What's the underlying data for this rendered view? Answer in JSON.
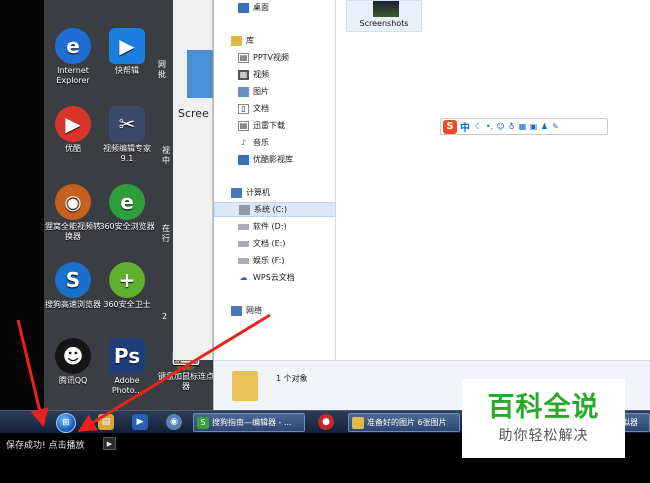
{
  "desktop": {
    "icons": [
      {
        "label": "Internet Explorer",
        "icon": "internet-explorer-icon",
        "color": "#1e6fd1"
      },
      {
        "label": "快帮辑",
        "icon": "video-play-icon",
        "color": "#1a7fe0"
      },
      {
        "label": "优酷",
        "icon": "youku-icon",
        "color": "#d9342b"
      },
      {
        "label": "视频编辑专家 9.1",
        "icon": "video-editor-icon",
        "color": "#3a4a6a"
      },
      {
        "label": "狸窝全能视频转换器",
        "icon": "leawo-converter-icon",
        "color": "#c6601e"
      },
      {
        "label": "360安全浏览器",
        "icon": "360-browser-icon",
        "color": "#2d9e3a"
      },
      {
        "label": "搜狗高速浏览器",
        "icon": "sogou-browser-icon",
        "color": "#1a6fc9"
      },
      {
        "label": "360安全卫士",
        "icon": "360-safe-icon",
        "color": "#5fb02c"
      },
      {
        "label": "腾讯QQ",
        "icon": "qq-icon",
        "color": "#151515"
      },
      {
        "label": "Adobe Photo...",
        "icon": "photoshop-icon",
        "color": "#1c3d7a"
      }
    ],
    "partial_labels": [
      "网",
      "批",
      "视",
      "中",
      "在",
      "行",
      "2"
    ],
    "bottom_partial_label": "键盘加鼠标连点器",
    "back_window_text": "Scree"
  },
  "explorer": {
    "nav": [
      {
        "label": "桌面",
        "icon": "desktop-icon",
        "indent": 1
      },
      {
        "label": "库",
        "icon": "library-icon",
        "indent": 0
      },
      {
        "label": "PPTV视频",
        "icon": "pptv-icon",
        "indent": 1
      },
      {
        "label": "视频",
        "icon": "video-icon",
        "indent": 1
      },
      {
        "label": "图片",
        "icon": "image-icon",
        "indent": 1
      },
      {
        "label": "文档",
        "icon": "document-icon",
        "indent": 1
      },
      {
        "label": "迅雷下载",
        "icon": "thunder-download-icon",
        "indent": 1
      },
      {
        "label": "音乐",
        "icon": "music-icon",
        "indent": 1
      },
      {
        "label": "优酷影视库",
        "icon": "youku-library-icon",
        "indent": 1
      },
      {
        "label": "计算机",
        "icon": "computer-icon",
        "indent": 0
      },
      {
        "label": "系统 (C:)",
        "icon": "drive-c-icon",
        "indent": 1,
        "selected": true
      },
      {
        "label": "软件 (D:)",
        "icon": "drive-icon",
        "indent": 1
      },
      {
        "label": "文档 (E:)",
        "icon": "drive-icon",
        "indent": 1
      },
      {
        "label": "娱乐 (F:)",
        "icon": "drive-icon",
        "indent": 1
      },
      {
        "label": "WPS云文档",
        "icon": "wps-cloud-icon",
        "indent": 1
      },
      {
        "label": "网络",
        "icon": "network-icon",
        "indent": 0
      }
    ],
    "folder_label": "Screenshots",
    "details_count": "1 个对象"
  },
  "ime": {
    "logo": "S",
    "mode": "中",
    "icons": [
      "moon-icon",
      "punctuation-icon",
      "emoji-icon",
      "microphone-icon",
      "keyboard-icon",
      "toolbox-icon",
      "shirt-icon",
      "wrench-icon"
    ]
  },
  "taskbar": {
    "tasks": [
      {
        "label": "搜狗指南—编辑器 - ...",
        "icon": "sogou-guide-icon",
        "color": "#3a9e3a"
      },
      {
        "label": "准备好的图片 6张图片",
        "icon": "folder-icon",
        "color": "#e1b84a"
      },
      {
        "label": "模拟器",
        "icon": "emulator-icon",
        "color": "#4a7ab5"
      }
    ]
  },
  "statusbar": {
    "message": "保存成功! 点击播放",
    "play_symbol": "▶"
  },
  "watermark": {
    "title": "百科全说",
    "subtitle": "助你轻松解决"
  },
  "colors": {
    "arrow": "#e8231c",
    "watermark_green": "#2aa82a"
  }
}
